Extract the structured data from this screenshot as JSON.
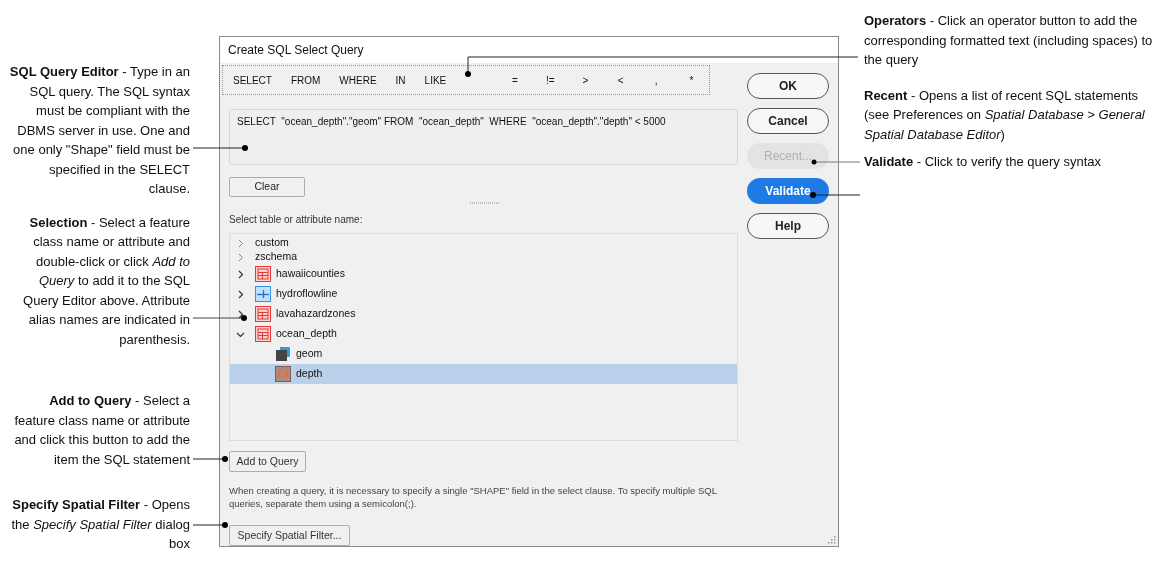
{
  "left_notes": [
    {
      "text": "**SQL Query Editor** - Type in an SQL query. The SQL syntax must be compliant with the DBMS server in use. One and one only \"Shape\" field must be specified in the SELECT clause."
    },
    {
      "text": "**Selection** - Select a feature class name or attribute and double-click or click *Add to Query* to add it to the SQL Query Editor above. Attribute alias names are indicated in parenthesis."
    },
    {
      "text": "**Add to Query** - Select a feature class name or attribute and click this button to add the item the SQL statement"
    },
    {
      "text": "**Specify Spatial Filter** - Opens the *Specify Spatial Filter* dialog box"
    }
  ],
  "right_notes": [
    {
      "text": "**Operators** - Click an operator button to add the corresponding formatted text (including spaces) to the query"
    },
    {
      "text": "**Recent** - Opens a list of recent SQL statements (see Preferences on *Spatial Database > General Spatial Database Editor*)"
    },
    {
      "text": "**Validate** - Click to verify the query syntax"
    }
  ],
  "dialog": {
    "title": "Create SQL Select Query",
    "operators": [
      {
        "label": "SELECT",
        "kind": "keyword"
      },
      {
        "label": "FROM",
        "kind": "keyword"
      },
      {
        "label": "WHERE",
        "kind": "keyword"
      },
      {
        "label": "IN",
        "kind": "keyword"
      },
      {
        "label": "LIKE",
        "kind": "keyword"
      },
      {
        "label": "=",
        "kind": "symbol"
      },
      {
        "label": "!=",
        "kind": "symbol"
      },
      {
        "label": ">",
        "kind": "symbol"
      },
      {
        "label": "<",
        "kind": "symbol"
      },
      {
        "label": ",",
        "kind": "symbol"
      },
      {
        "label": "*",
        "kind": "symbol"
      }
    ],
    "query_text": "SELECT  \"ocean_depth\".\"geom\" FROM  \"ocean_depth\"  WHERE  \"ocean_depth\".\"depth\" < 5000",
    "clear_button": "Clear",
    "tree_label": "Select table or attribute name:",
    "tree": [
      {
        "label": "custom",
        "kind": "schema",
        "expanded": false,
        "selected": false
      },
      {
        "label": "zschema",
        "kind": "schema",
        "expanded": false,
        "selected": false
      },
      {
        "label": "hawaiicounties",
        "kind": "polygon",
        "expanded": false,
        "selected": false
      },
      {
        "label": "hydroflowline",
        "kind": "line",
        "expanded": false,
        "selected": false
      },
      {
        "label": "lavahazardzones",
        "kind": "polygon",
        "expanded": false,
        "selected": false
      },
      {
        "label": "ocean_depth",
        "kind": "polygon",
        "expanded": true,
        "selected": false,
        "children": [
          {
            "label": "geom",
            "kind": "geometry",
            "selected": false
          },
          {
            "label": "depth",
            "kind": "field",
            "selected": true
          }
        ]
      }
    ],
    "add_button": "Add to Query",
    "hint": "When creating a query, it is necessary to specify a single \"SHAPE\" field in the select clause. To specify multiple SQL queries, separate them using a semicolon(;).",
    "filter_button": "Specify Spatial Filter...",
    "side_buttons": [
      {
        "label": "OK",
        "disabled": false,
        "primary": false
      },
      {
        "label": "Cancel",
        "disabled": false,
        "primary": false
      },
      {
        "label": "Recent...",
        "disabled": true,
        "primary": false
      },
      {
        "label": "Validate",
        "disabled": false,
        "primary": true
      },
      {
        "label": "Help",
        "disabled": false,
        "primary": false
      }
    ]
  }
}
